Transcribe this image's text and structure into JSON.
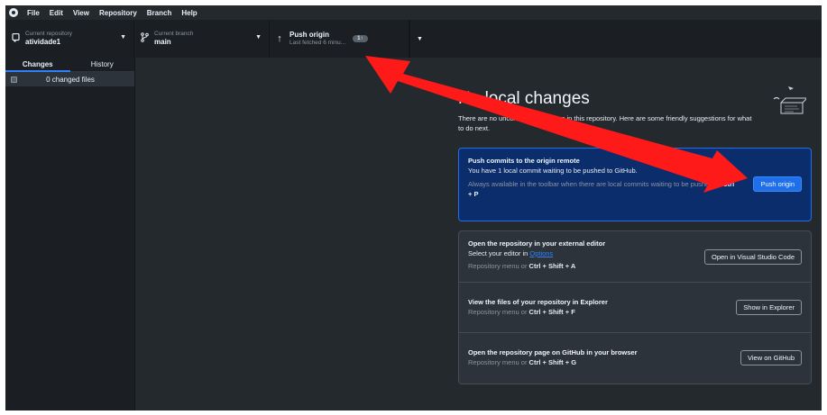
{
  "menu": [
    "File",
    "Edit",
    "View",
    "Repository",
    "Branch",
    "Help"
  ],
  "toolbar": {
    "repo": {
      "sub": "Current repository",
      "name": "atividade1"
    },
    "branch": {
      "sub": "Current branch",
      "name": "main"
    },
    "push": {
      "title": "Push origin",
      "sub": "Last fetched 6 minu...",
      "badge": "1↑"
    }
  },
  "sidebar": {
    "tabs": [
      "Changes",
      "History"
    ],
    "changed_files": "0 changed files"
  },
  "main": {
    "heading": "No local changes",
    "intro": "There are no uncommitted changes in this repository. Here are some friendly suggestions for what to do next.",
    "push_card": {
      "title": "Push commits to the origin remote",
      "desc": "You have 1 local commit waiting to be pushed to GitHub.",
      "hint": "Always available in the toolbar when there are local commits waiting to be pushed or",
      "shortcut": "Ctrl + P",
      "button": "Push origin"
    },
    "editor_card": {
      "title": "Open the repository in your external editor",
      "desc_prefix": "Select your editor in ",
      "desc_link": "Options",
      "hint": "Repository menu or ",
      "shortcut": "Ctrl + Shift + A",
      "button": "Open in Visual Studio Code"
    },
    "explorer_card": {
      "title": "View the files of your repository in Explorer",
      "hint": "Repository menu or ",
      "shortcut": "Ctrl + Shift + F",
      "button": "Show in Explorer"
    },
    "github_card": {
      "title": "Open the repository page on GitHub in your browser",
      "hint": "Repository menu or ",
      "shortcut": "Ctrl + Shift + G",
      "button": "View on GitHub"
    }
  },
  "colors": {
    "arrow": "#ff1a1a",
    "accent": "#1f6feb"
  }
}
